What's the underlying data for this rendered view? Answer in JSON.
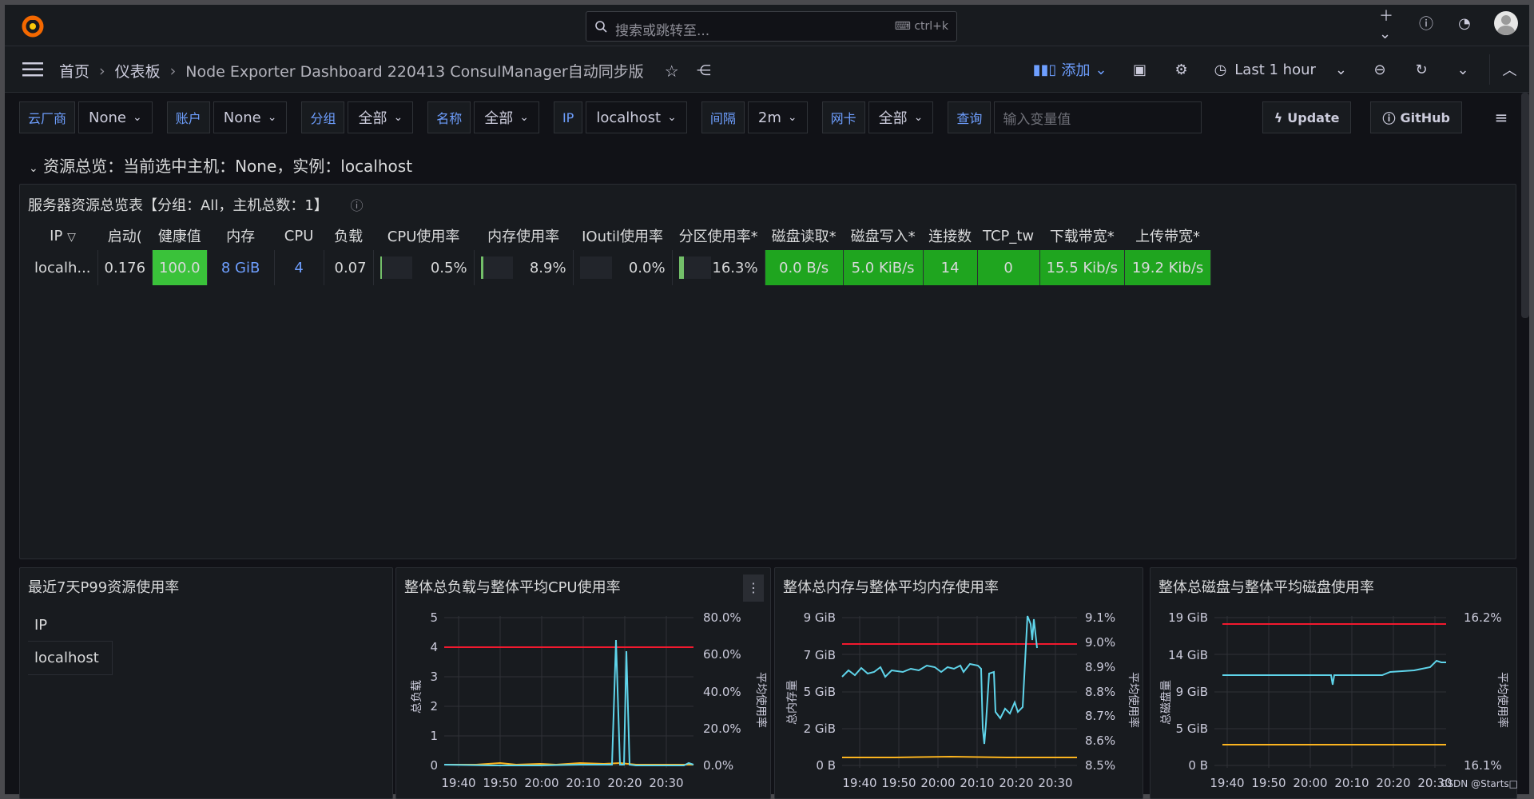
{
  "topbar": {
    "search_placeholder": "搜索或跳转至...",
    "shortcut": "ctrl+k"
  },
  "navbar": {
    "crumbs": [
      "首页",
      "仪表板",
      "Node Exporter Dashboard 220413 ConsulManager自动同步版"
    ],
    "add_label": "添加",
    "time_range": "Last 1 hour"
  },
  "variables": [
    {
      "label": "云厂商",
      "value": "None"
    },
    {
      "label": "账户",
      "value": "None"
    },
    {
      "label": "分组",
      "value": "全部"
    },
    {
      "label": "名称",
      "value": "全部"
    },
    {
      "label": "IP",
      "value": "localhost"
    },
    {
      "label": "间隔",
      "value": "2m"
    },
    {
      "label": "网卡",
      "value": "全部"
    }
  ],
  "query": {
    "label": "查询",
    "placeholder": "输入变量值"
  },
  "links": {
    "update": "Update",
    "github": "GitHub"
  },
  "row_title": "资源总览：当前选中主机：None，实例：localhost",
  "overview": {
    "title": "服务器资源总览表【分组：All，主机总数：1】",
    "headers": [
      "IP",
      "启动(",
      "健康值",
      "内存",
      "CPU",
      "负载",
      "CPU使用率",
      "内存使用率",
      "IOutil使用率",
      "分区使用率*",
      "磁盘读取*",
      "磁盘写入*",
      "连接数",
      "TCP_tw",
      "下载带宽*",
      "上传带宽*"
    ],
    "row": {
      "ip": "localh...",
      "uptime": "0.176",
      "health": "100.0",
      "mem": "8 GiB",
      "cpu": "4",
      "load": "0.07",
      "cpu_pct": "0.5%",
      "cpu_frac": 0.005,
      "mem_pct": "8.9%",
      "mem_frac": 0.089,
      "io_pct": "0.0%",
      "io_frac": 0.0,
      "part_pct": "16.3%",
      "part_frac": 0.163,
      "disk_read": "0.0 B/s",
      "disk_write": "5.0 KiB/s",
      "conn": "14",
      "tcp_tw": "0",
      "down": "15.5 Kib/s",
      "up": "19.2 Kib/s"
    }
  },
  "p99": {
    "title": "最近7天P99资源使用率",
    "header": "IP",
    "value": "localhost"
  },
  "charts": {
    "cpu": {
      "title": "整体总负载与整体平均CPU使用率",
      "y_ticks": [
        "5",
        "4",
        "3",
        "2",
        "1",
        "0"
      ],
      "y2_ticks": [
        "80.0%",
        "60.0%",
        "40.0%",
        "20.0%",
        "0.0%"
      ],
      "x_ticks": [
        "19:40",
        "19:50",
        "20:00",
        "20:10",
        "20:20",
        "20:30"
      ],
      "ylabel": "总负载",
      "y2label": "平均使用率"
    },
    "mem": {
      "title": "整体总内存与整体平均内存使用率",
      "y_ticks": [
        "9 GiB",
        "7 GiB",
        "5 GiB",
        "2 GiB",
        "0 B"
      ],
      "y2_ticks": [
        "9.1%",
        "9.0%",
        "8.9%",
        "8.8%",
        "8.7%",
        "8.6%",
        "8.5%"
      ],
      "x_ticks": [
        "19:40",
        "19:50",
        "20:00",
        "20:10",
        "20:20",
        "20:30"
      ],
      "ylabel": "总内存量",
      "y2label": "平均使用率"
    },
    "disk": {
      "title": "整体总磁盘与整体平均磁盘使用率",
      "y_ticks": [
        "19 GiB",
        "14 GiB",
        "9 GiB",
        "5 GiB",
        "0 B"
      ],
      "y2_ticks": [
        "16.2%",
        "16.1%"
      ],
      "x_ticks": [
        "19:40",
        "19:50",
        "20:00",
        "20:10",
        "20:20",
        "20:30"
      ],
      "ylabel": "总磁盘量",
      "y2label": "平均使用率"
    }
  },
  "watermark": "CSDN @Starts□"
}
